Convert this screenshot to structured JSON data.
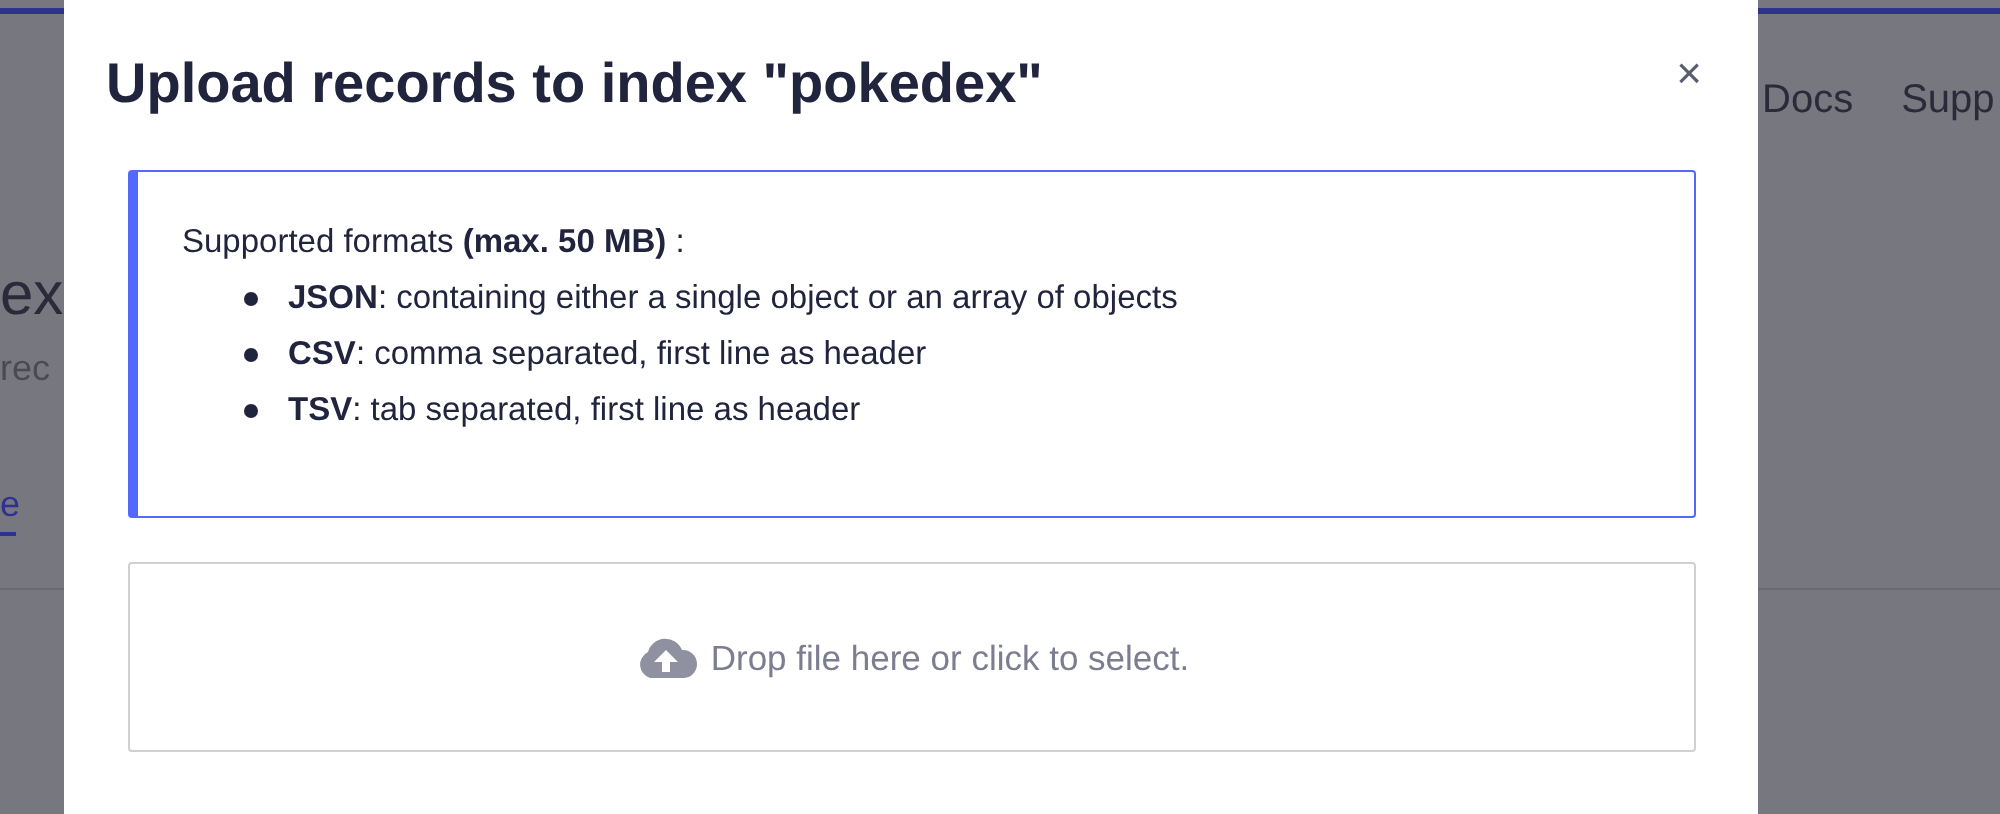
{
  "background": {
    "heading": "ex",
    "subheading": "rec",
    "tabs": [
      {
        "label": "e",
        "selected": true
      }
    ],
    "nav_links": [
      "Docs",
      "Supp"
    ]
  },
  "modal": {
    "title": "Upload records to index \"pokedex\"",
    "close": "×",
    "info": {
      "intro": "Supported formats **(max. 50 MB)** :",
      "formats": [
        "**JSON**: containing either a single object or an array of objects",
        "**CSV**: comma separated, first line as header",
        "**TSV**: tab separated, first line as header"
      ]
    },
    "dropzone": {
      "text": "Drop file here or click to select."
    }
  }
}
